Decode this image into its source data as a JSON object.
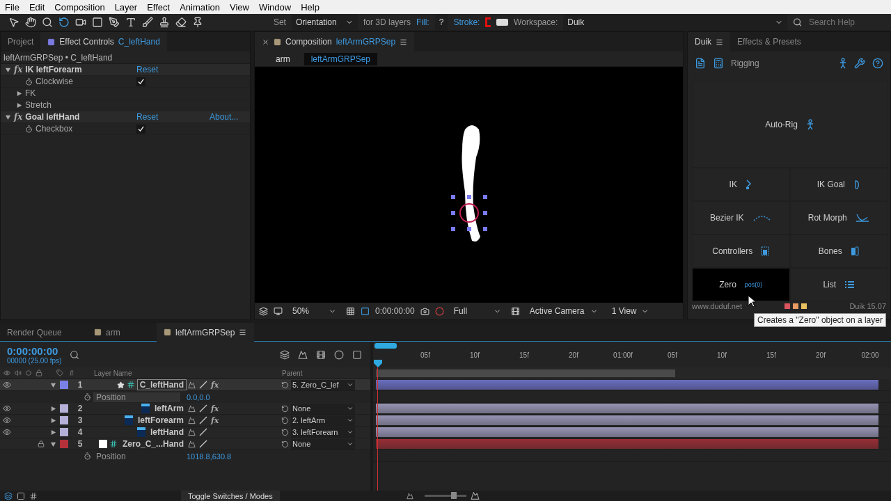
{
  "menu": [
    "File",
    "Edit",
    "Composition",
    "Layer",
    "Effect",
    "Animation",
    "View",
    "Window",
    "Help"
  ],
  "toolbar": {
    "set_label": "Set",
    "orientation": "Orientation",
    "for_3d": "for 3D layers",
    "fill_label": "Fill:",
    "fill_value": "?",
    "stroke_label": "Stroke:",
    "workspace_label": "Workspace:",
    "workspace": "Duik",
    "search_placeholder": "Search Help"
  },
  "effect_panel": {
    "tabs": [
      {
        "label": "Project",
        "selected": false
      },
      {
        "label": "Effect Controls",
        "target": "C_leftHand",
        "selected": true
      }
    ],
    "breadcrumb": "leftArmGRPSep • C_leftHand",
    "effects": [
      {
        "fx": "fx",
        "name": "IK leftForearm",
        "expanded": true,
        "reset": "Reset",
        "properties": [
          {
            "kind": "checkbox",
            "label": "Clockwise",
            "checked": true
          },
          {
            "kind": "group",
            "label": "FK"
          },
          {
            "kind": "group",
            "label": "Stretch"
          }
        ]
      },
      {
        "fx": "fx",
        "name": "Goal leftHand",
        "expanded": true,
        "reset": "Reset",
        "about": "About...",
        "properties": [
          {
            "kind": "checkbox",
            "label": "Checkbox",
            "checked": true
          }
        ]
      }
    ]
  },
  "composition": {
    "title": "Composition",
    "name": "leftArmGRPSep",
    "breadcrumbs": [
      {
        "label": "arm",
        "selected": false
      },
      {
        "label": "leftArmGRPSep",
        "selected": true
      }
    ],
    "zoom": "50%",
    "timecode": "0:00:00:00",
    "resolution": "Full",
    "camera": "Active Camera",
    "views": "1 View"
  },
  "duik": {
    "tabs": [
      {
        "label": "Duik",
        "selected": true
      },
      {
        "label": "Effects & Presets",
        "selected": false
      }
    ],
    "section": "Rigging",
    "buttons": [
      {
        "label": "Auto-Rig",
        "selected": false
      },
      {
        "label": "IK",
        "selected": false
      },
      {
        "label": "IK Goal",
        "selected": false
      },
      {
        "label": "Bezier IK",
        "selected": false
      },
      {
        "label": "Rot Morph",
        "selected": false
      },
      {
        "label": "Controllers",
        "selected": false
      },
      {
        "label": "Bones",
        "selected": false
      },
      {
        "label": "Zero",
        "hint": "pos(0)",
        "selected": true
      },
      {
        "label": "List",
        "selected": false
      }
    ],
    "website": "www.duduf.net",
    "swatches": [
      {
        "color": "#d9545c"
      },
      {
        "color": "#e89a62"
      },
      {
        "color": "#e8c25e"
      }
    ],
    "version": "Duik 15.07",
    "tooltip": "Creates a \"Zero\" object on a layer"
  },
  "timeline": {
    "tabs": [
      {
        "label": "Render Queue",
        "selected": false
      },
      {
        "label": "arm",
        "selected": false
      },
      {
        "label": "leftArmGRPSep",
        "selected": true
      }
    ],
    "timecode": "0:00:00:00",
    "fps": "00000 (25.00 fps)",
    "columns": {
      "number": "#",
      "layer_name": "Layer Name",
      "parent": "Parent"
    },
    "ruler": [
      "05f",
      "10f",
      "15f",
      "20f",
      "01:00f",
      "05f",
      "10f",
      "15f",
      "20f",
      "02:00"
    ],
    "layers": [
      {
        "number": "1",
        "name": "C_leftHand",
        "kind": "null",
        "starred": true,
        "color": "#7b80e6",
        "visible": true,
        "locked": false,
        "expanded": true,
        "selected": true,
        "fx": "fx",
        "parent": "5. Zero_C_lef",
        "property": {
          "label": "Position",
          "value": "0.0,0.0"
        }
      },
      {
        "number": "2",
        "name": "leftArm",
        "kind": "psd",
        "starred": false,
        "color": "#b4b0d8",
        "visible": true,
        "locked": false,
        "expanded": false,
        "selected": false,
        "fx": "fx",
        "parent": "None"
      },
      {
        "number": "3",
        "name": "leftForearm",
        "kind": "psd",
        "starred": false,
        "color": "#b4b0d8",
        "visible": true,
        "locked": false,
        "expanded": false,
        "selected": false,
        "fx": "fx",
        "parent": "2. leftArm"
      },
      {
        "number": "4",
        "name": "leftHand",
        "kind": "psd",
        "starred": false,
        "color": "#b4b0d8",
        "visible": true,
        "locked": false,
        "expanded": false,
        "selected": false,
        "parent": "3. leftForearn"
      },
      {
        "number": "5",
        "name": "Zero_C_...Hand",
        "kind": "solid-null",
        "starred": false,
        "color": "#b4303a",
        "visible": false,
        "locked": true,
        "expanded": true,
        "selected": false,
        "parent": "None",
        "property": {
          "label": "Position",
          "value": "1018.8,630.8"
        }
      }
    ],
    "toggle": "Toggle Switches / Modes",
    "zoom_slider": {
      "level": 0.7
    }
  }
}
